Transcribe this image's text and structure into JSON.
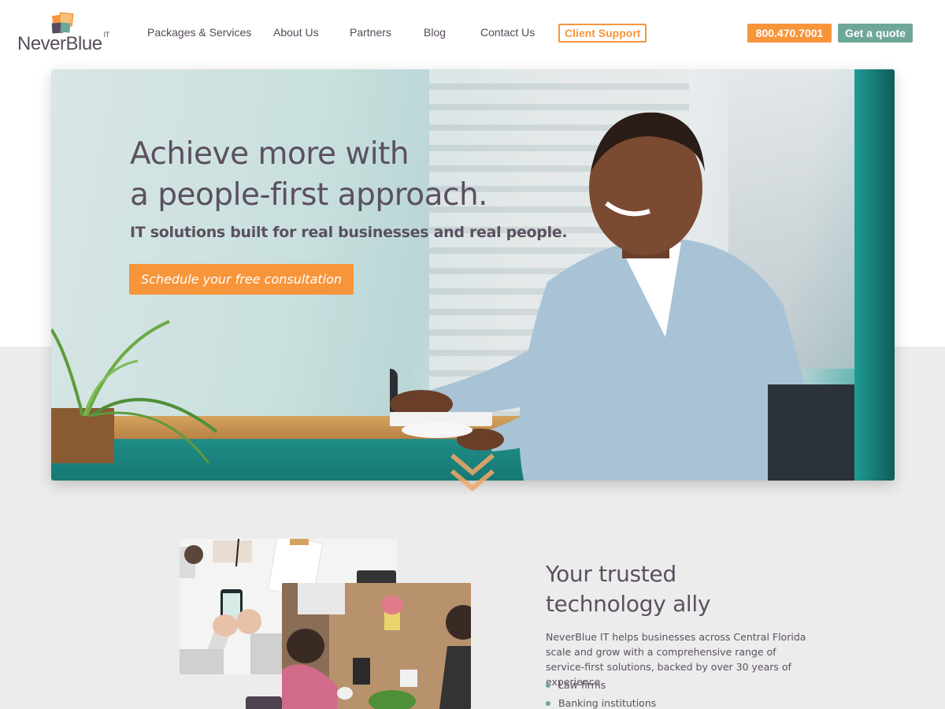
{
  "brand": {
    "name": "NeverBlue",
    "superscript": "IT",
    "colors": {
      "orange": "#f7953b",
      "teal": "#6ea79a",
      "text": "#5b5060",
      "logo_dark": "#574d5c"
    }
  },
  "nav": {
    "items": [
      "Packages & Services",
      "About Us",
      "Partners",
      "Blog",
      "Contact Us"
    ],
    "client_support": "Client Support",
    "phone": "800.470.7001",
    "quote": "Get a quote"
  },
  "hero": {
    "title_line1": "Achieve more with",
    "title_line2": "a people-first approach.",
    "subtitle": "IT solutions built for real businesses and real people.",
    "cta": "Schedule your free consultation",
    "scroll_icon": "double-chevron-down-icon"
  },
  "about": {
    "title_line1": "Your trusted",
    "title_line2": "technology ally",
    "body": "NeverBlue IT helps businesses across Central Florida scale and grow with a comprehensive range of service-first solutions, backed by over 30 years of experience.",
    "list": [
      "Law firms",
      "Banking institutions"
    ]
  }
}
